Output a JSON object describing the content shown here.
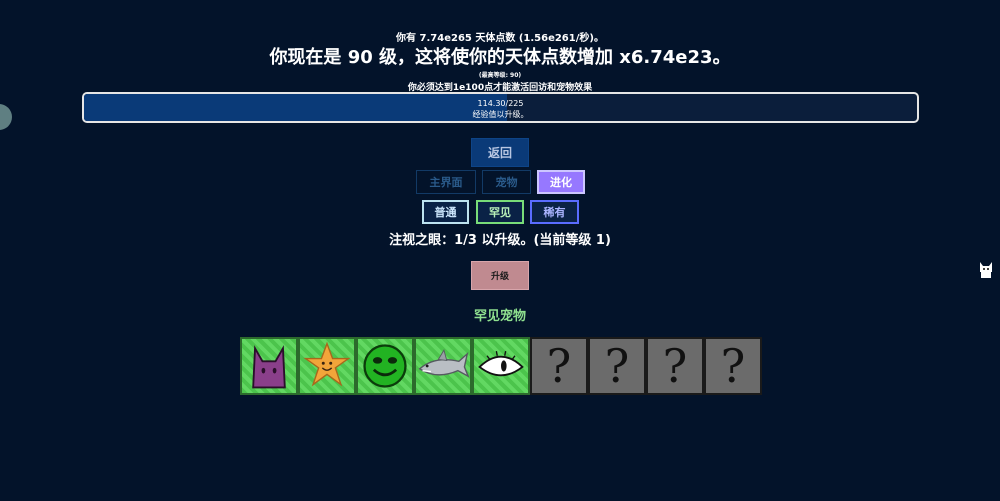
{
  "header": {
    "points_text": "你有 7.74e265 天体点数 (1.56e261/秒)。",
    "level_text": "你现在是 90 级，这将使你的天体点数增加 x6.74e23。",
    "max_level_text": "(最高等级: 90)",
    "requirement_text": "你必须达到1e100点才能激活回访和宠物效果"
  },
  "xp": {
    "value_text": "114.30/225",
    "label_text": "经验值以升级。",
    "progress_fraction": 0.508
  },
  "nav": {
    "back_label": "返回",
    "tabs": [
      "主界面",
      "宠物",
      "进化"
    ],
    "active_tab": "进化"
  },
  "rarity": {
    "common_label": "普通",
    "uncommon_label": "罕见",
    "rare_label": "稀有"
  },
  "evolution": {
    "status_text": "注视之眼：1/3 以升级。(当前等级 1)",
    "upgrade_label": "升级"
  },
  "pets": {
    "section_title": "罕见宠物",
    "tiles": [
      {
        "icon": "purple-cat-pet-icon",
        "locked": false
      },
      {
        "icon": "orange-star-pet-icon",
        "locked": false
      },
      {
        "icon": "green-smiley-pet-icon",
        "locked": false
      },
      {
        "icon": "gray-shark-pet-icon",
        "locked": false
      },
      {
        "icon": "eye-pet-icon",
        "locked": false
      },
      {
        "icon": "question-mark-icon",
        "locked": true,
        "label": "?"
      },
      {
        "icon": "question-mark-icon",
        "locked": true,
        "label": "?"
      },
      {
        "icon": "question-mark-icon",
        "locked": true,
        "label": "?"
      },
      {
        "icon": "question-mark-icon",
        "locked": true,
        "label": "?"
      }
    ]
  },
  "colors": {
    "background": "#03132a",
    "xp_fill": "#0a3a78",
    "active_tab": "#9678ff",
    "section_title": "#8fe08f",
    "upgrade_button": "#c08a90"
  }
}
